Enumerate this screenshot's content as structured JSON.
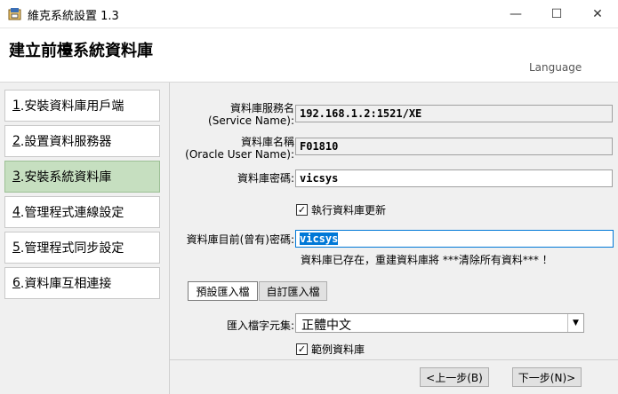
{
  "window": {
    "title": "維克系統設置 1.3",
    "minimize": "—",
    "maximize": "☐",
    "close": "✕"
  },
  "header": {
    "heading": "建立前檯系統資料庫",
    "language": "Language"
  },
  "steps": [
    {
      "num": "1",
      "label": ".安裝資料庫用戶端"
    },
    {
      "num": "2",
      "label": ".設置資料服務器"
    },
    {
      "num": "3",
      "label": ".安裝系統資料庫"
    },
    {
      "num": "4",
      "label": ".管理程式連線設定"
    },
    {
      "num": "5",
      "label": ".管理程式同步設定"
    },
    {
      "num": "6",
      "label": ".資料庫互相連接"
    }
  ],
  "form": {
    "service_label_1": "資料庫服務名",
    "service_label_2": "(Service Name):",
    "service_value": "192.168.1.2:1521/XE",
    "user_label_1": "資料庫名稱",
    "user_label_2": "(Oracle User Name):",
    "user_value": "F01810",
    "password_label": "資料庫密碼:",
    "password_value": "vicsys",
    "update_check_label": "執行資料庫更新",
    "current_password_label": "資料庫目前(曾有)密碼:",
    "current_password_value": "vicsys",
    "warning": "資料庫已存在，重建資料庫將 ***清除所有資料*** ！",
    "default_import_button": "預設匯入檔",
    "custom_import_button": "自訂匯入檔",
    "charset_label": "匯入檔字元集:",
    "charset_value": "正體中文",
    "sample_check_label": "範例資料庫"
  },
  "footer": {
    "prev_button": "<上一步(B)",
    "next_button": "下一步(N)>"
  }
}
